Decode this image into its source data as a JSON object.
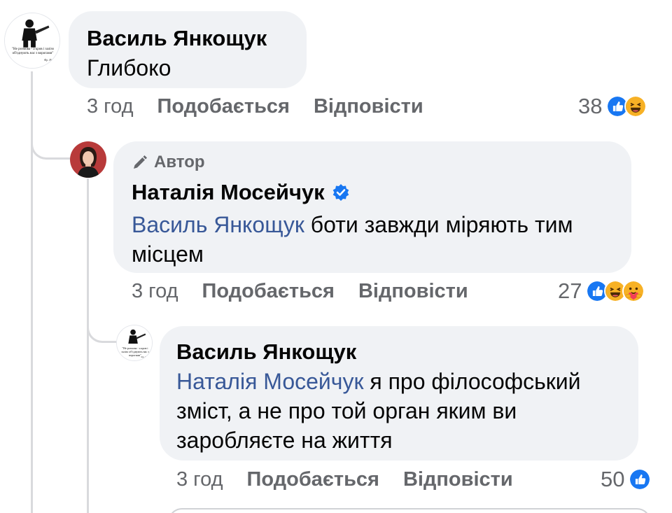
{
  "comments": [
    {
      "author": "Василь Янкощук",
      "text": "Глибоко",
      "time": "3 год",
      "like_label": "Подобається",
      "reply_label": "Відповісти",
      "reaction_count": "38",
      "reactions": [
        "like-icon",
        "haha-icon"
      ],
      "avatar_caption": "\"Не розмова - а кров і залізо об'єднують нас з ворогами\"",
      "avatar_signature": "Фр. Ніцше"
    },
    {
      "badge": "Автор",
      "author": "Наталія Мосейчук",
      "verified": true,
      "mention": "Василь Янкощук",
      "text": "боти завжди міряють тим місцем",
      "time": "3 год",
      "like_label": "Подобається",
      "reply_label": "Відповісти",
      "reaction_count": "27",
      "reactions": [
        "like-icon",
        "haha-icon",
        "care-icon"
      ]
    },
    {
      "author": "Василь Янкощук",
      "mention": "Наталія Мосейчук",
      "text": "я про філософський зміст, а не про той орган яким ви заробляєте на життя",
      "time": "3 год",
      "like_label": "Подобається",
      "reply_label": "Відповісти",
      "reaction_count": "50",
      "reactions": [
        "like-icon"
      ],
      "avatar_caption": "\"Не розмова - а кров і залізо об'єднують нас з ворогами\"",
      "avatar_signature": "Фр. Ніцше"
    }
  ],
  "colors": {
    "bubble": "#f0f2f5",
    "mention": "#385898",
    "meta": "#65676b",
    "like_blue": "#1877f2",
    "reaction_yellow": "#f7b125"
  }
}
